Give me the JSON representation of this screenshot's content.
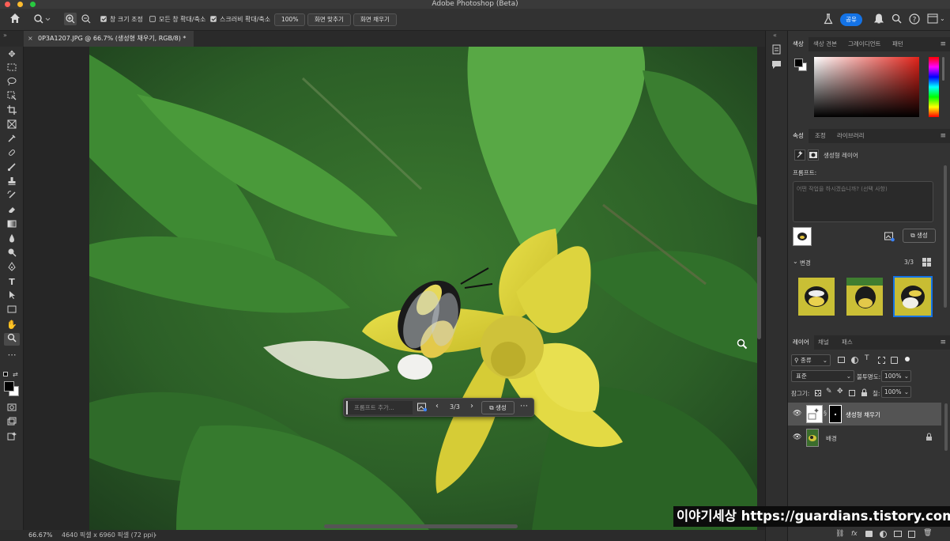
{
  "window": {
    "title": "Adobe Photoshop (Beta)"
  },
  "options_bar": {
    "resize_windows": "창 크기 조정",
    "zoom_all_windows": "모든 창 확대/축소",
    "scrubby_zoom": "스크러비 확대/축소",
    "zoom_value": "100%",
    "fit_screen": "화면 맞추기",
    "fill_screen": "화면 채우기",
    "share": "공유"
  },
  "document_tab": {
    "title": "0P3A1207.JPG @ 66.7% (생성형 채우기, RGB/8) *"
  },
  "taskbar": {
    "prompt_placeholder": "프롬프트 추가...",
    "variation_counter": "3/3",
    "generate_label": "생성"
  },
  "status_bar": {
    "zoom": "66.67%",
    "doc_info": "4640 픽셀 x 6960 픽셀 (72 ppi)"
  },
  "color_panel": {
    "tabs": [
      "색상",
      "색상 견본",
      "그레이디언트",
      "패턴"
    ],
    "foreground": "#000000",
    "background": "#ffffff",
    "hue": "#e2231a"
  },
  "properties_panel": {
    "tabs": [
      "속성",
      "조정",
      "라이브러리"
    ],
    "layer_kind": "생성형 레이어",
    "prompt_label": "프롬프트:",
    "prompt_placeholder": "어떤 작업을 하시겠습니까? (선택 사항)",
    "generate_label": "생성",
    "variations_label": "변경",
    "variations_count": "3/3"
  },
  "layers_panel": {
    "tabs": [
      "레이어",
      "채널",
      "패스"
    ],
    "filter_kind": "종류",
    "blend_mode": "표준",
    "opacity_label": "불투명도:",
    "opacity_value": "100%",
    "lock_label": "잠그기:",
    "fill_label": "칠:",
    "fill_value": "100%",
    "layers": [
      {
        "name": "생성형 채우기"
      },
      {
        "name": "배경"
      }
    ]
  },
  "watermark": {
    "text": "이야기세상 https://guardians.tistory.com"
  }
}
